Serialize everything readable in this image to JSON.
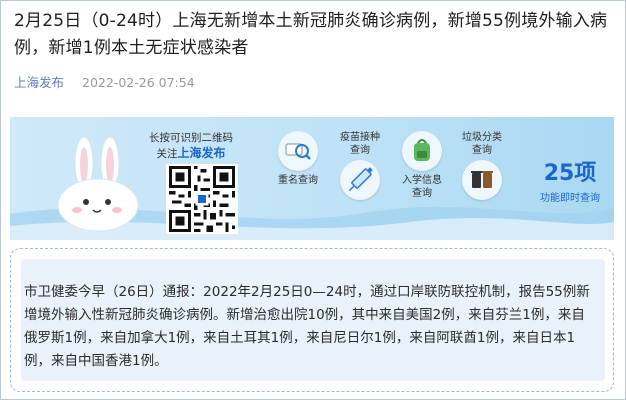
{
  "article": {
    "title": "2月25日（0-24时）上海无新增本土新冠肺炎确诊病例，新增55例境外输入病例，新增1例本土无症状感染者",
    "source": "上海发布",
    "datetime": "2022-02-26 07:54"
  },
  "banner": {
    "qr_caption_line1": "长按可识别二维码",
    "qr_caption_line2": "关注",
    "qr_caption_brand": "上海发布",
    "services": [
      {
        "label": "重名查询",
        "icon": "magnifier-icon"
      },
      {
        "label": "疫苗接种\n查询",
        "icon": "syringe-icon"
      },
      {
        "label": "入学信息\n查询",
        "icon": "backpack-icon"
      },
      {
        "label": "垃圾分类\n查询",
        "icon": "trash-bins-icon"
      }
    ],
    "count_value": "25项",
    "count_sub": "功能即时查询"
  },
  "notice": {
    "text": "市卫健委今早（26日）通报：2022年2月25日0—24时，通过口岸联防联控机制，报告55例新增境外输入性新冠肺炎确诊病例。新增治愈出院10例，其中来自美国2例，来自芬兰1例，来自俄罗斯1例，来自加拿大1例，来自土耳其1例，来自尼日尔1例，来自阿联酋1例，来自日本1例，来自中国香港1例。"
  },
  "colors": {
    "brand_blue": "#1a66c9",
    "banner_bg": "#bfe2f6",
    "notice_bg": "#e9f2fb",
    "source_link": "#5f7fb5"
  }
}
